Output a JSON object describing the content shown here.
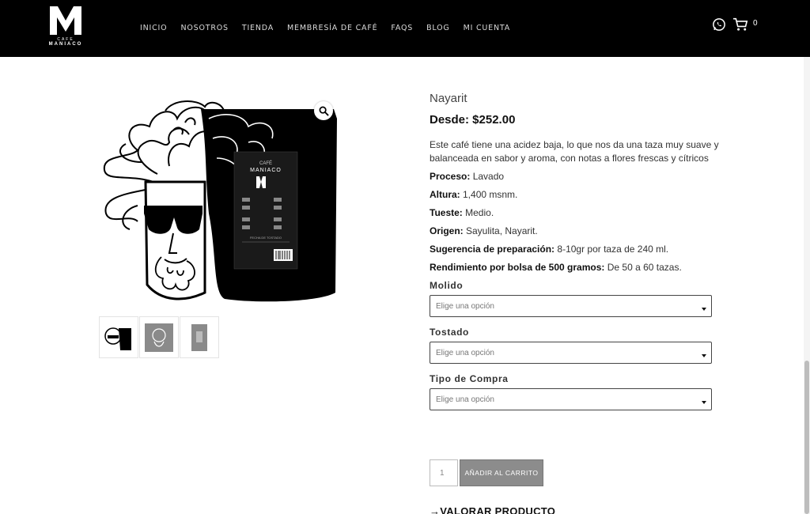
{
  "header": {
    "logo": {
      "line1": "CAFE",
      "line2": "MANIACO"
    },
    "nav": [
      {
        "label": "INICIO"
      },
      {
        "label": "NOSOTROS"
      },
      {
        "label": "TIENDA"
      },
      {
        "label": "MEMBRESÍA DE CAFÉ"
      },
      {
        "label": "FAQS"
      },
      {
        "label": "BLOG"
      },
      {
        "label": "MI CUENTA"
      }
    ],
    "cart_count": "0",
    "icons": [
      "whatsapp-icon",
      "cart-icon"
    ]
  },
  "gallery": {
    "bag_text": {
      "brand": "CAFÉ",
      "name": "MANIACO",
      "date_label": "FECHA DE TOSTADO"
    },
    "thumbnails": 3
  },
  "product": {
    "title": "Nayarit",
    "price": "Desde: $252.00",
    "description": "Este café tiene una acidez baja, lo que nos da una taza muy suave y balanceada en sabor y aroma, con notas a flores frescas y cítricos",
    "attributes": [
      {
        "label": "Proceso:",
        "value": " Lavado"
      },
      {
        "label": "Altura:",
        "value": " 1,400 msnm."
      },
      {
        "label": "Tueste:",
        "value": " Medio."
      },
      {
        "label": "Origen:",
        "value": " Sayulita, Nayarit."
      },
      {
        "label": "Sugerencia de preparación:",
        "value": " 8-10gr por taza de 240 ml."
      },
      {
        "label": "Rendimiento por bolsa de 500 gramos:",
        "value": " De 50 a 60 tazas."
      }
    ],
    "variations": [
      {
        "label": "Molido",
        "placeholder": "Elige una opción"
      },
      {
        "label": "Tostado",
        "placeholder": "Elige una opción"
      },
      {
        "label": "Tipo de Compra",
        "placeholder": "Elige una opción"
      }
    ],
    "quantity": "1",
    "add_to_cart": "AÑADIR AL CARRITO",
    "review_link": "→VALORAR PRODUCTO"
  },
  "colors": {
    "header_bg": "#000000",
    "button_bg": "#8c8c8c"
  }
}
